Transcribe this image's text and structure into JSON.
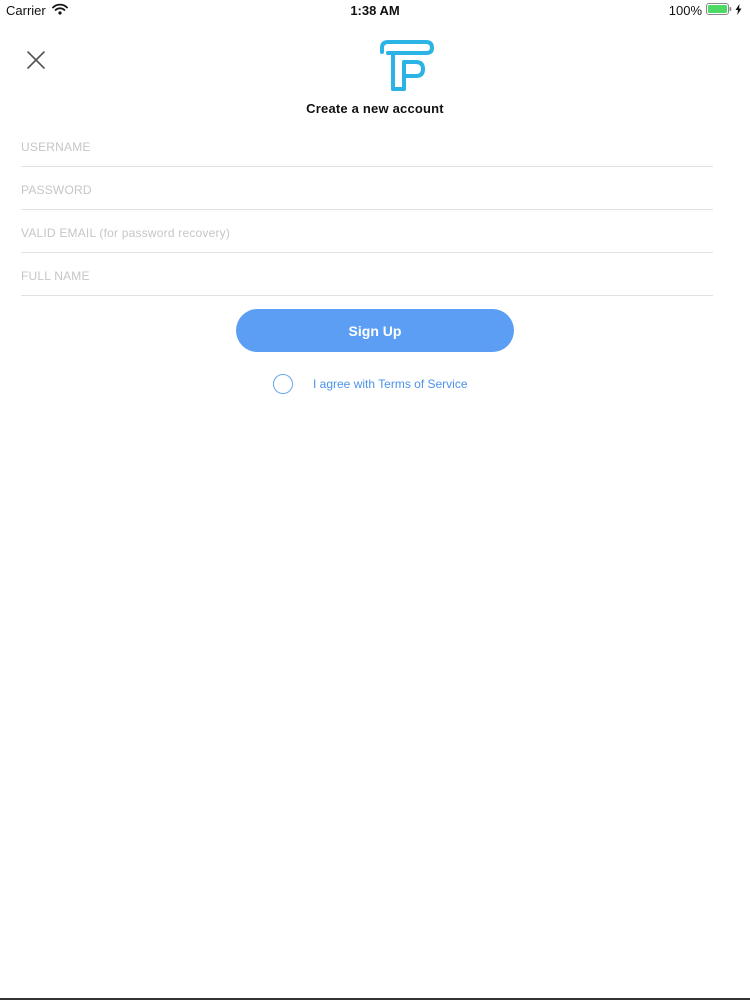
{
  "status_bar": {
    "carrier": "Carrier",
    "time": "1:38 AM",
    "battery": "100%",
    "icons": [
      "wifi-icon",
      "battery-icon",
      "bolt-icon"
    ]
  },
  "header": {
    "close_icon": "close-icon",
    "logo_icon": "brand-logo",
    "title": "Create a new account"
  },
  "form": {
    "username": {
      "placeholder": "USERNAME",
      "value": ""
    },
    "password": {
      "placeholder": "PASSWORD",
      "value": ""
    },
    "email": {
      "placeholder": "VALID EMAIL (for password recovery)",
      "value": ""
    },
    "fullname": {
      "placeholder": "FULL NAME",
      "value": ""
    },
    "signup_label": "Sign Up",
    "terms_label": "I agree with Terms of Service",
    "terms_checked": false
  },
  "colors": {
    "accent": "#5b9ef3",
    "link": "#4b93ea",
    "logo": "#2bb3e6",
    "battery": "#4cd964",
    "placeholder": "#c6c6c6",
    "divider": "#e2e2e2"
  }
}
